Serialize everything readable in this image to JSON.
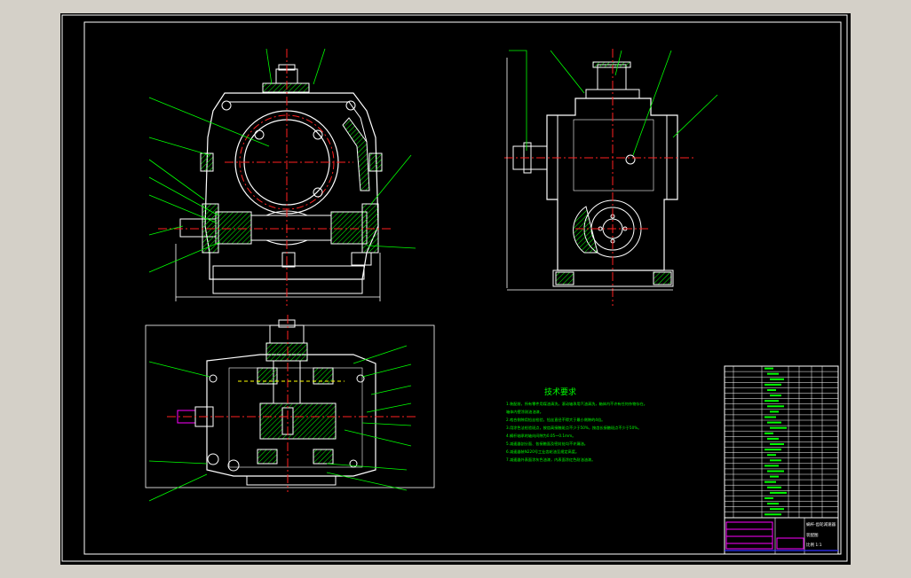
{
  "app": {
    "background_color": "#d4d0c8",
    "viewport_color": "#000000"
  },
  "colors": {
    "frame": "#ffffff",
    "outline": "#ffffff",
    "leader": "#00ff00",
    "center": "#ff2020",
    "hidden": "#ffff00",
    "hatch": "#00ff00",
    "part": "#ff00ff",
    "title_cell": "#ff00ff",
    "title_line": "#3030ff"
  },
  "tech_requirements": {
    "title": "技术要求",
    "lines": [
      "1.装配前，所有零件用煤油清洗，滚动轴承用汽油清洗，箱体内不许有任何杂物存在。",
      "   箱体内壁涂耐油油漆。",
      "2.啮合侧隙用铅丝检验，铅丝直径不得大于最小侧隙的4倍。",
      "3.用涂色法检验斑点，按齿高接触斑点不少于50%，按齿长接触斑点不少于50%。",
      "4.蜗杆轴承的轴向间隙为0.05～0.1mm。",
      "   5.减速器剖分面、各接触面及密封处均不许漏油。",
      "   6.减速器装N220号工业齿轮油至规定高度。",
      "   7.减速器外表面涂灰色油漆，内表面涂红色耐油油漆。"
    ]
  },
  "title_block": {
    "line1": "蜗杆-齿轮减速器",
    "line2": "装配图",
    "line3": "比例 1:1"
  }
}
